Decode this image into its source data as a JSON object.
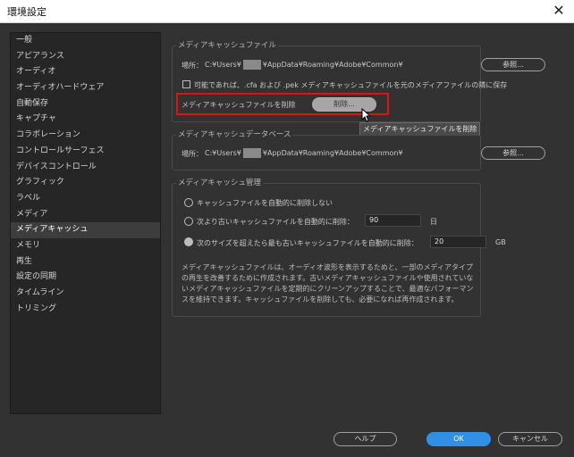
{
  "window": {
    "title": "環境設定",
    "close_glyph": "✕"
  },
  "sidebar": {
    "items": [
      {
        "label": "一般"
      },
      {
        "label": "アピアランス"
      },
      {
        "label": "オーディオ"
      },
      {
        "label": "オーディオハードウェア"
      },
      {
        "label": "自動保存"
      },
      {
        "label": "キャプチャ"
      },
      {
        "label": "コラボレーション"
      },
      {
        "label": "コントロールサーフェス"
      },
      {
        "label": "デバイスコントロール"
      },
      {
        "label": "グラフィック"
      },
      {
        "label": "ラベル"
      },
      {
        "label": "メディア"
      },
      {
        "label": "メディアキャッシュ"
      },
      {
        "label": "メモリ"
      },
      {
        "label": "再生"
      },
      {
        "label": "設定の同期"
      },
      {
        "label": "タイムライン"
      },
      {
        "label": "トリミング"
      }
    ],
    "selected": "メディアキャッシュ"
  },
  "cache_files": {
    "title": "メディアキャッシュファイル",
    "location_label": "場所：",
    "path_prefix": "C:¥Users¥",
    "path_suffix": "¥AppData¥Roaming¥Adobe¥Common¥",
    "browse_button": "参照...",
    "checkbox_label": "可能であれば、.cfa および .pek メディアキャッシュファイルを元のメディアファイルの隣に保存",
    "checkbox_checked": false,
    "delete_label": "メディアキャッシュファイルを削除",
    "delete_button": "削除...",
    "tooltip": "メディアキャッシュファイルを削除"
  },
  "cache_db": {
    "title": "メディアキャッシュデータベース",
    "location_label": "場所：",
    "path_prefix": "C:¥Users¥",
    "path_suffix": "¥AppData¥Roaming¥Adobe¥Common¥",
    "browse_button": "参照..."
  },
  "cache_mgmt": {
    "title": "メディアキャッシュ管理",
    "option1": "キャッシュファイルを自動的に削除しない",
    "option2": "次より古いキャッシュファイルを自動的に削除：",
    "option2_value": "90",
    "option2_unit": "日",
    "option3": "次のサイズを超えたら最も古いキャッシュファイルを自動的に削除：",
    "option3_value": "20",
    "option3_unit": "GB",
    "selected_option": 3,
    "description": "メディアキャッシュファイルは、オーディオ波形を表示するためと、一部のメディアタイプの再生を改善するために作成されます。古いメディアキャッシュファイルや使用されていないメディアキャッシュファイルを定期的にクリーンアップすることで、最適なパフォーマンスを維持できます。キャッシュファイルを削除しても、必要になれば再作成されます。"
  },
  "footer": {
    "help": "ヘルプ",
    "ok": "OK",
    "cancel": "キャンセル"
  },
  "colors": {
    "background": "#323232",
    "panel": "#262626",
    "accent": "#2f90e6",
    "highlight_box": "#e01212"
  }
}
